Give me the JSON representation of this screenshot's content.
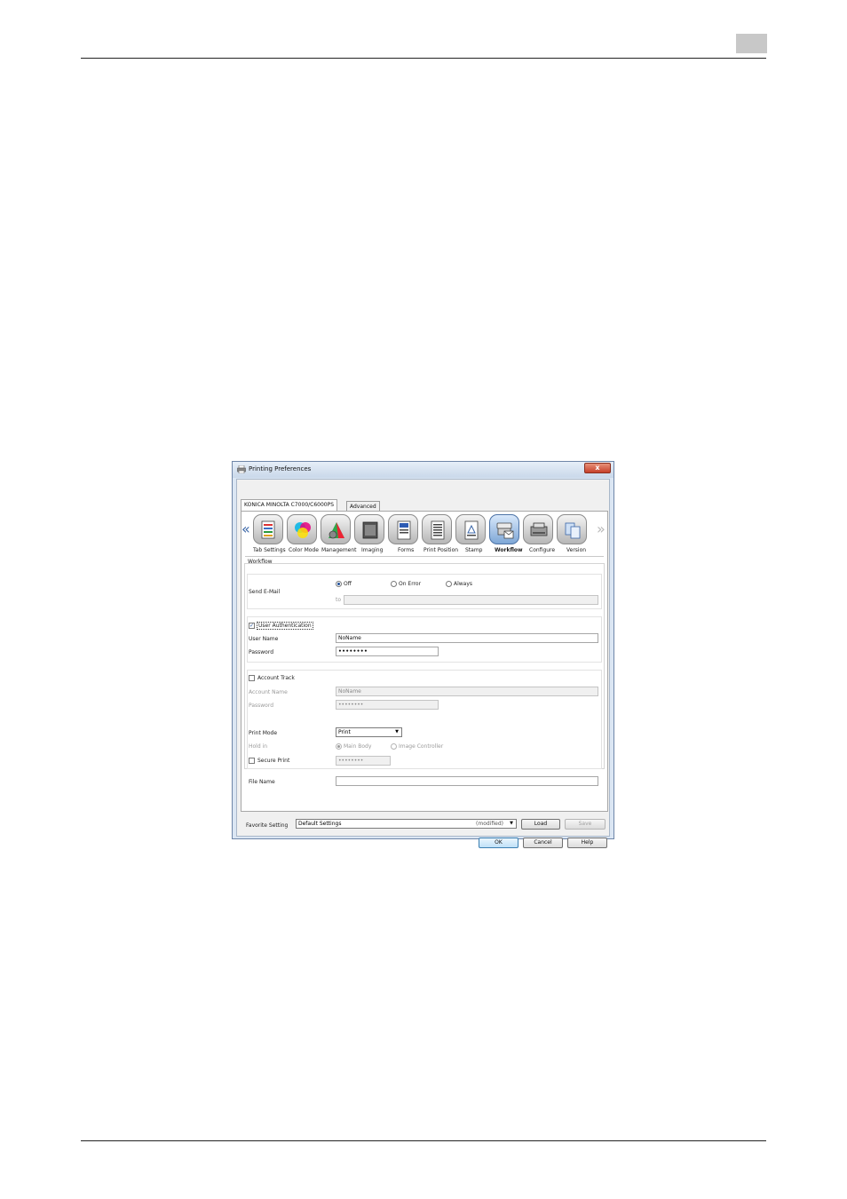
{
  "window": {
    "title": "Printing Preferences",
    "close_glyph": "x"
  },
  "tabs": [
    "KONICA MINOLTA C7000/C6000PS",
    "Advanced"
  ],
  "toolbar": {
    "prev_glyph": "«",
    "next_glyph": "»",
    "items": [
      {
        "label": "Tab Settings",
        "icon": "tab-settings-icon"
      },
      {
        "label": "Color Mode",
        "icon": "color-mode-icon"
      },
      {
        "label": "Management",
        "icon": "color-management-icon"
      },
      {
        "label": "Imaging",
        "icon": "imaging-icon"
      },
      {
        "label": "Forms",
        "icon": "forms-icon"
      },
      {
        "label": "Print Position",
        "icon": "print-position-icon"
      },
      {
        "label": "Stamp",
        "icon": "stamp-icon"
      },
      {
        "label": "Workflow",
        "icon": "workflow-icon",
        "active": true
      },
      {
        "label": "Configure",
        "icon": "configure-icon"
      },
      {
        "label": "Version",
        "icon": "version-icon"
      }
    ]
  },
  "workflow": {
    "section_title": "Workflow",
    "send_email": {
      "label": "Send E-Mail",
      "options": [
        "Off",
        "On Error",
        "Always"
      ],
      "selected": "Off",
      "to_label": "to",
      "to_value": ""
    },
    "user_auth": {
      "label": "User Authentication",
      "checked": true,
      "user_name_label": "User Name",
      "user_name_value": "NoName",
      "password_label": "Password",
      "password_value": "••••••••"
    },
    "account_track": {
      "label": "Account Track",
      "checked": false,
      "account_name_label": "Account Name",
      "account_name_value": "NoName",
      "password_label": "Password",
      "password_value": "••••••••"
    },
    "print_mode": {
      "label": "Print Mode",
      "value": "Print",
      "hold_in_label": "Hold in",
      "hold_options": [
        "Main Body",
        "Image Controller"
      ],
      "hold_selected": "Main Body",
      "secure_print_label": "Secure Print",
      "secure_print_checked": false,
      "secure_password_value": "••••••••"
    },
    "file_name": {
      "label": "File Name",
      "value": ""
    }
  },
  "favorite": {
    "label": "Favorite Setting",
    "value": "Default Settings",
    "modified": "(modified)",
    "load_label": "Load",
    "save_label": "Save"
  },
  "buttons": {
    "ok": "OK",
    "cancel": "Cancel",
    "help": "Help"
  }
}
